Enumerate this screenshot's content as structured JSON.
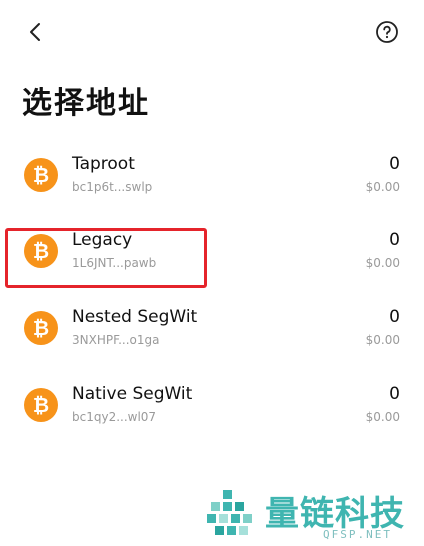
{
  "header": {
    "back_icon": "chevron-left-icon",
    "help_icon": "question-circle-icon"
  },
  "page": {
    "title": "选择地址"
  },
  "addresses": [
    {
      "name": "Taproot",
      "short": "bc1p6t...swlp",
      "amount": "0",
      "fiat": "$0.00"
    },
    {
      "name": "Legacy",
      "short": "1L6JNT...pawb",
      "amount": "0",
      "fiat": "$0.00"
    },
    {
      "name": "Nested SegWit",
      "short": "3NXHPF...o1ga",
      "amount": "0",
      "fiat": "$0.00"
    },
    {
      "name": "Native SegWit",
      "short": "bc1qy2...wl07",
      "amount": "0",
      "fiat": "$0.00"
    }
  ],
  "coin_symbol": "₿",
  "colors": {
    "bitcoin": "#f7931a",
    "highlight": "#e5242b",
    "watermark": "#3fb5b0"
  },
  "watermark": {
    "text": "量链科技",
    "sub": "QFSP.NET"
  }
}
